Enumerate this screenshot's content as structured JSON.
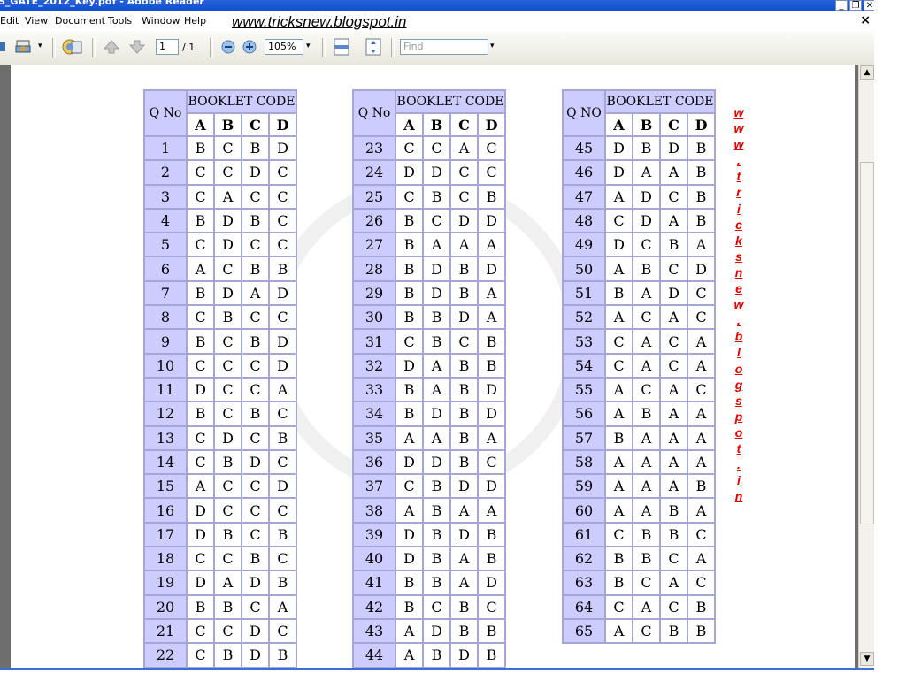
{
  "window": {
    "title": "S_GATE_2012_Key.pdf - Adobe Reader",
    "buttons": [
      "_",
      "❐",
      "✕"
    ]
  },
  "menubar": {
    "items": [
      "Edit",
      "View",
      "Document",
      "Tools",
      "Window",
      "Help"
    ],
    "url_text": "www.tricksnew.blogspot.in",
    "close": "×"
  },
  "toolbar": {
    "page_current": "1",
    "page_total": "/ 1",
    "zoom": "105%",
    "find_placeholder": "Find"
  },
  "document": {
    "header_qno": [
      "Q No",
      "Q No",
      "Q NO"
    ],
    "header_booklet": "BOOKLET CODE",
    "booklet_letters": [
      "A",
      "B",
      "C",
      "D"
    ],
    "side_text": [
      "w",
      "w",
      "w",
      ".",
      "t",
      "r",
      "i",
      "c",
      "k",
      "s",
      "n",
      "e",
      "w",
      ".",
      "b",
      "l",
      "o",
      "g",
      "s",
      "p",
      "o",
      "t",
      ".",
      "i",
      "n"
    ],
    "tables": [
      {
        "rows": [
          {
            "q": "1",
            "a": [
              "B",
              "C",
              "B",
              "D"
            ]
          },
          {
            "q": "2",
            "a": [
              "C",
              "C",
              "D",
              "C"
            ]
          },
          {
            "q": "3",
            "a": [
              "C",
              "A",
              "C",
              "C"
            ]
          },
          {
            "q": "4",
            "a": [
              "B",
              "D",
              "B",
              "C"
            ]
          },
          {
            "q": "5",
            "a": [
              "C",
              "D",
              "C",
              "C"
            ]
          },
          {
            "q": "6",
            "a": [
              "A",
              "C",
              "B",
              "B"
            ]
          },
          {
            "q": "7",
            "a": [
              "B",
              "D",
              "A",
              "D"
            ]
          },
          {
            "q": "8",
            "a": [
              "C",
              "B",
              "C",
              "C"
            ]
          },
          {
            "q": "9",
            "a": [
              "B",
              "C",
              "B",
              "D"
            ]
          },
          {
            "q": "10",
            "a": [
              "C",
              "C",
              "C",
              "D"
            ]
          },
          {
            "q": "11",
            "a": [
              "D",
              "C",
              "C",
              "A"
            ]
          },
          {
            "q": "12",
            "a": [
              "B",
              "C",
              "B",
              "C"
            ]
          },
          {
            "q": "13",
            "a": [
              "C",
              "D",
              "C",
              "B"
            ]
          },
          {
            "q": "14",
            "a": [
              "C",
              "B",
              "D",
              "C"
            ]
          },
          {
            "q": "15",
            "a": [
              "A",
              "C",
              "C",
              "D"
            ]
          },
          {
            "q": "16",
            "a": [
              "D",
              "C",
              "C",
              "C"
            ]
          },
          {
            "q": "17",
            "a": [
              "D",
              "B",
              "C",
              "B"
            ]
          },
          {
            "q": "18",
            "a": [
              "C",
              "C",
              "B",
              "C"
            ]
          },
          {
            "q": "19",
            "a": [
              "D",
              "A",
              "D",
              "B"
            ]
          },
          {
            "q": "20",
            "a": [
              "B",
              "B",
              "C",
              "A"
            ]
          },
          {
            "q": "21",
            "a": [
              "C",
              "C",
              "D",
              "C"
            ]
          },
          {
            "q": "22",
            "a": [
              "C",
              "B",
              "D",
              "B"
            ]
          }
        ]
      },
      {
        "rows": [
          {
            "q": "23",
            "a": [
              "C",
              "C",
              "A",
              "C"
            ]
          },
          {
            "q": "24",
            "a": [
              "D",
              "D",
              "C",
              "C"
            ]
          },
          {
            "q": "25",
            "a": [
              "C",
              "B",
              "C",
              "B"
            ]
          },
          {
            "q": "26",
            "a": [
              "B",
              "C",
              "D",
              "D"
            ]
          },
          {
            "q": "27",
            "a": [
              "B",
              "A",
              "A",
              "A"
            ]
          },
          {
            "q": "28",
            "a": [
              "B",
              "D",
              "B",
              "D"
            ]
          },
          {
            "q": "29",
            "a": [
              "B",
              "D",
              "B",
              "A"
            ]
          },
          {
            "q": "30",
            "a": [
              "B",
              "B",
              "D",
              "A"
            ]
          },
          {
            "q": "31",
            "a": [
              "C",
              "B",
              "C",
              "B"
            ]
          },
          {
            "q": "32",
            "a": [
              "D",
              "A",
              "B",
              "B"
            ]
          },
          {
            "q": "33",
            "a": [
              "B",
              "A",
              "B",
              "D"
            ]
          },
          {
            "q": "34",
            "a": [
              "B",
              "D",
              "B",
              "D"
            ]
          },
          {
            "q": "35",
            "a": [
              "A",
              "A",
              "B",
              "A"
            ]
          },
          {
            "q": "36",
            "a": [
              "D",
              "D",
              "B",
              "C"
            ]
          },
          {
            "q": "37",
            "a": [
              "C",
              "B",
              "D",
              "D"
            ]
          },
          {
            "q": "38",
            "a": [
              "A",
              "B",
              "A",
              "A"
            ]
          },
          {
            "q": "39",
            "a": [
              "D",
              "B",
              "D",
              "B"
            ]
          },
          {
            "q": "40",
            "a": [
              "D",
              "B",
              "A",
              "B"
            ]
          },
          {
            "q": "41",
            "a": [
              "B",
              "B",
              "A",
              "D"
            ]
          },
          {
            "q": "42",
            "a": [
              "B",
              "C",
              "B",
              "C"
            ]
          },
          {
            "q": "43",
            "a": [
              "A",
              "D",
              "B",
              "B"
            ]
          },
          {
            "q": "44",
            "a": [
              "A",
              "B",
              "D",
              "B"
            ]
          }
        ]
      },
      {
        "rows": [
          {
            "q": "45",
            "a": [
              "D",
              "B",
              "D",
              "B"
            ]
          },
          {
            "q": "46",
            "a": [
              "D",
              "A",
              "A",
              "B"
            ]
          },
          {
            "q": "47",
            "a": [
              "A",
              "D",
              "C",
              "B"
            ]
          },
          {
            "q": "48",
            "a": [
              "C",
              "D",
              "A",
              "B"
            ]
          },
          {
            "q": "49",
            "a": [
              "D",
              "C",
              "B",
              "A"
            ]
          },
          {
            "q": "50",
            "a": [
              "A",
              "B",
              "C",
              "D"
            ]
          },
          {
            "q": "51",
            "a": [
              "B",
              "A",
              "D",
              "C"
            ]
          },
          {
            "q": "52",
            "a": [
              "A",
              "C",
              "A",
              "C"
            ]
          },
          {
            "q": "53",
            "a": [
              "C",
              "A",
              "C",
              "A"
            ]
          },
          {
            "q": "54",
            "a": [
              "C",
              "A",
              "C",
              "A"
            ]
          },
          {
            "q": "55",
            "a": [
              "A",
              "C",
              "A",
              "C"
            ]
          },
          {
            "q": "56",
            "a": [
              "A",
              "B",
              "A",
              "A"
            ]
          },
          {
            "q": "57",
            "a": [
              "B",
              "A",
              "A",
              "A"
            ]
          },
          {
            "q": "58",
            "a": [
              "A",
              "A",
              "A",
              "A"
            ]
          },
          {
            "q": "59",
            "a": [
              "A",
              "A",
              "A",
              "B"
            ]
          },
          {
            "q": "60",
            "a": [
              "A",
              "A",
              "B",
              "A"
            ]
          },
          {
            "q": "61",
            "a": [
              "C",
              "B",
              "B",
              "C"
            ]
          },
          {
            "q": "62",
            "a": [
              "B",
              "B",
              "C",
              "A"
            ]
          },
          {
            "q": "63",
            "a": [
              "B",
              "C",
              "A",
              "C"
            ]
          },
          {
            "q": "64",
            "a": [
              "C",
              "A",
              "C",
              "B"
            ]
          },
          {
            "q": "65",
            "a": [
              "A",
              "C",
              "B",
              "B"
            ]
          }
        ]
      }
    ]
  }
}
